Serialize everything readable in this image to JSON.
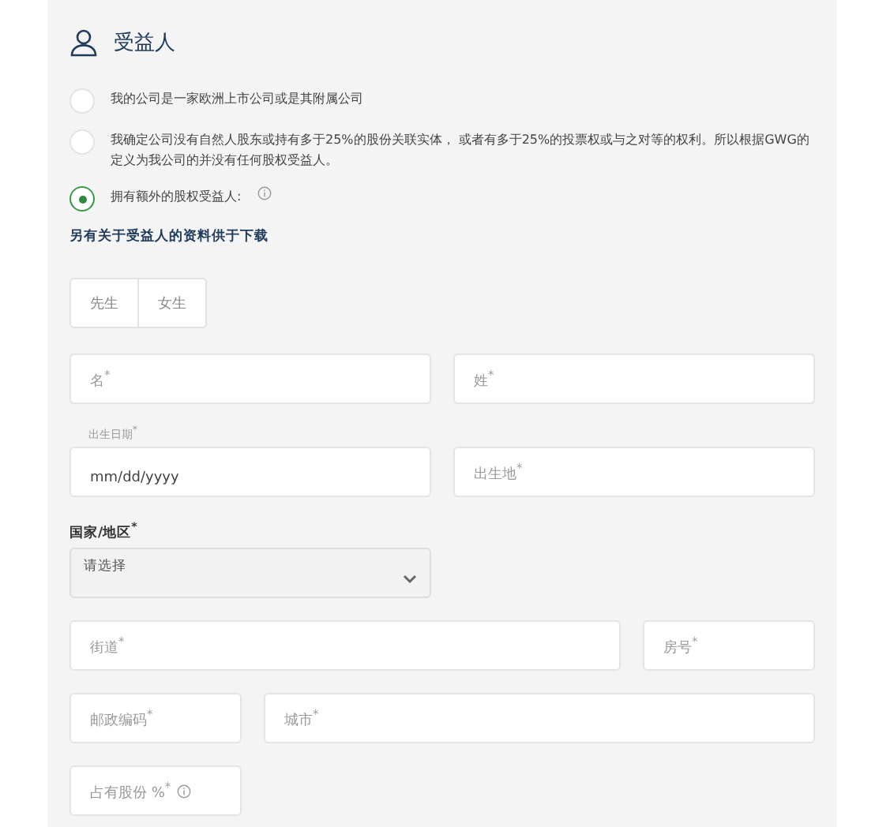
{
  "section": {
    "title": "受益人"
  },
  "options": [
    {
      "label": "我的公司是一家欧洲上市公司或是其附属公司",
      "selected": false,
      "info": false
    },
    {
      "label": "我确定公司没有自然人股东或持有多于25%的股份关联实体， 或者有多于25%的投票权或与之对等的权利。所以根据GWG的定义为我公司的并没有任何股权受益人。",
      "selected": false,
      "info": false
    },
    {
      "label": "拥有额外的股权受益人:",
      "selected": true,
      "info": true
    }
  ],
  "download_link": "另有关于受益人的资料供于下载",
  "salutation": [
    {
      "label": "先生",
      "selected": false
    },
    {
      "label": "女生",
      "selected": false
    }
  ],
  "rows": [
    [
      {
        "kind": "text",
        "placeholder": "名$^{*}$"
      },
      {
        "kind": "text",
        "placeholder": "姓$^{*}$"
      }
    ],
    [
      {
        "kind": "date",
        "label": "出生日期$^{*}$",
        "value": "mm/dd/yyyy"
      },
      {
        "kind": "text",
        "placeholder": "出生地$^{*}$"
      }
    ],
    [
      {
        "kind": "select",
        "label": "国家/地区$^{*}$",
        "value": "请选择"
      }
    ],
    [
      {
        "kind": "text",
        "placeholder": "街道$^{*}$"
      },
      {
        "kind": "text",
        "placeholder": "房号$^{*}$"
      }
    ],
    [
      {
        "kind": "text",
        "placeholder": "邮政编码$^{*}$"
      },
      {
        "kind": "text",
        "placeholder": "城市$^{*}$"
      }
    ],
    [
      {
        "kind": "text",
        "placeholder": "占有股份 %$^{*}$",
        "info": true
      }
    ]
  ]
}
